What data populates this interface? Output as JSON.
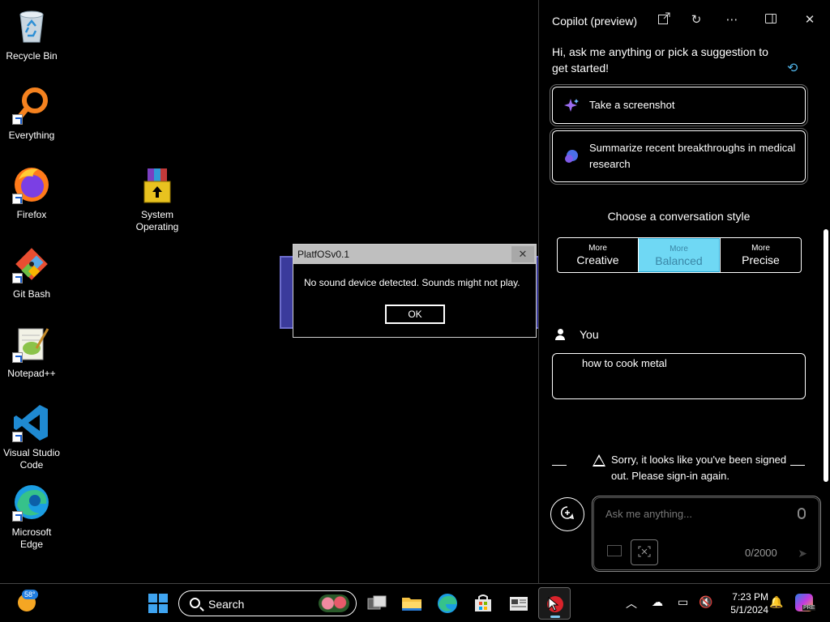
{
  "desktop": {
    "icons": [
      {
        "label": "Recycle Bin",
        "icon": "recycle-bin-icon"
      },
      {
        "label": "Everything",
        "icon": "magnifier-icon"
      },
      {
        "label": "Firefox",
        "icon": "firefox-icon"
      },
      {
        "label": "Git Bash",
        "icon": "git-icon"
      },
      {
        "label": "Notepad++",
        "icon": "notepad-plus-plus-icon"
      },
      {
        "label": "Visual Studio Code",
        "icon": "vscode-icon"
      },
      {
        "label": "Microsoft Edge",
        "icon": "edge-icon"
      },
      {
        "label": "System Operating",
        "icon": "winrar-archive-icon"
      }
    ]
  },
  "dialog": {
    "title": "PlatfOSv0.1",
    "close_label": "✕",
    "message": "No sound device detected. Sounds might not play.",
    "ok_label": "OK"
  },
  "copilot": {
    "title": "Copilot (preview)",
    "greeting": "Hi, ask me anything or pick a suggestion to get started!",
    "suggestions": [
      {
        "label": "Take a screenshot",
        "icon": "sparkle-icon"
      },
      {
        "label": "Summarize recent breakthroughs in medical research",
        "icon": "chat-bubbles-icon"
      }
    ],
    "style_title": "Choose a conversation style",
    "styles": [
      {
        "more": "More",
        "name": "Creative",
        "selected": false
      },
      {
        "more": "More",
        "name": "Balanced",
        "selected": true
      },
      {
        "more": "More",
        "name": "Precise",
        "selected": false
      }
    ],
    "you_label": "You",
    "user_message": "how to cook metal",
    "signout_message": "Sorry, it looks like you've been signed out. Please sign-in again.",
    "input_placeholder": "Ask me anything...",
    "char_counter": "0/2000",
    "accent_color": "#6fd8f4"
  },
  "taskbar": {
    "temperature": "58°",
    "search_label": "Search",
    "time": "7:23 PM",
    "date": "5/1/2024",
    "pre_badge": "PRE",
    "apps": [
      "start-icon",
      "task-view-icon",
      "file-explorer-icon",
      "edge-icon",
      "store-icon",
      "news-icon",
      "copilot-running-app-icon"
    ]
  }
}
